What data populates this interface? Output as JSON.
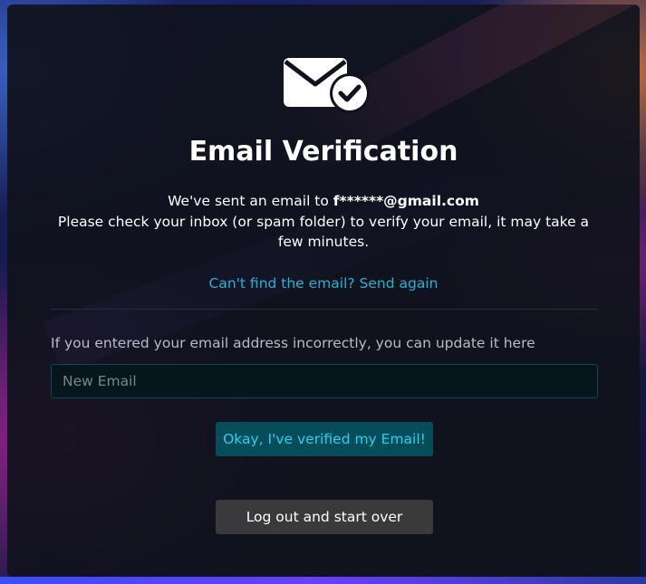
{
  "title": "Email Verification",
  "message": {
    "line1_prefix": "We've sent an email to ",
    "email": "f******@gmail.com",
    "line2": "Please check your inbox (or spam folder) to verify your email, it may take a few minutes."
  },
  "resend_link": "Can't find the email? Send again",
  "update": {
    "label": "If you entered your email address incorrectly, you can update it here",
    "placeholder": "New Email",
    "value": ""
  },
  "buttons": {
    "verified": "Okay, I've verified my Email!",
    "logout": "Log out and start over"
  },
  "icons": {
    "header": "email-check-icon"
  },
  "colors": {
    "accent": "#21b4d4",
    "primary_button_bg": "#064d5a",
    "primary_button_text": "#27d1ee",
    "secondary_button_bg": "#3a3a3c",
    "card_bg": "#10121c"
  }
}
